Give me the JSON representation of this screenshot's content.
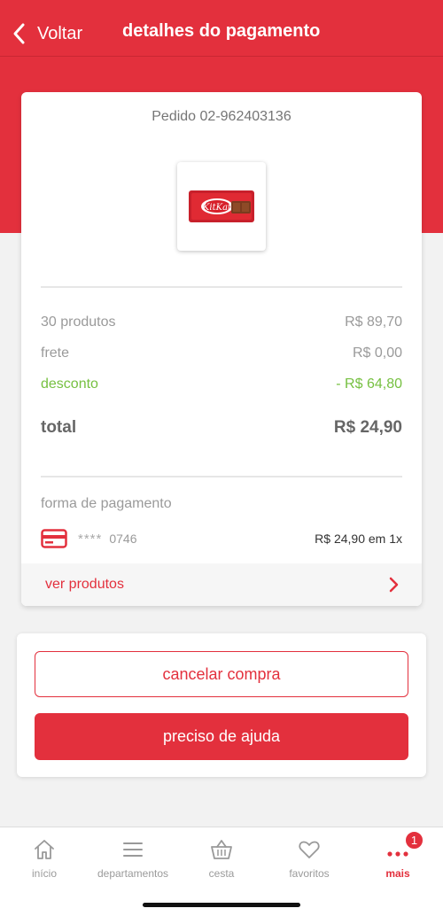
{
  "header": {
    "back_label": "Voltar",
    "title": "detalhes do pagamento"
  },
  "order": {
    "id_label": "Pedido 02-962403136",
    "product_image_icon": "kitkat-product-image",
    "product_brand": "KitKat",
    "summary": {
      "products_label": "30 produtos",
      "products_value": "R$ 89,70",
      "shipping_label": "frete",
      "shipping_value": "R$ 0,00",
      "discount_label": "desconto",
      "discount_value": "- R$ 64,80",
      "total_label": "total",
      "total_value": "R$ 24,90"
    },
    "payment": {
      "label": "forma de pagamento",
      "card_icon": "credit-card-icon",
      "card_mask": "****",
      "card_last_digits": "0746",
      "amount": "R$ 24,90 em 1x"
    },
    "see_products_label": "ver produtos"
  },
  "actions": {
    "cancel_label": "cancelar compra",
    "help_label": "preciso de ajuda"
  },
  "tabbar": {
    "items": [
      {
        "label": "início",
        "icon": "home-icon"
      },
      {
        "label": "departamentos",
        "icon": "menu-icon"
      },
      {
        "label": "cesta",
        "icon": "basket-icon"
      },
      {
        "label": "favoritos",
        "icon": "heart-icon"
      },
      {
        "label": "mais",
        "icon": "more-icon",
        "badge": "1"
      }
    ]
  },
  "colors": {
    "brand": "#e3303d",
    "discount": "#76c041"
  }
}
